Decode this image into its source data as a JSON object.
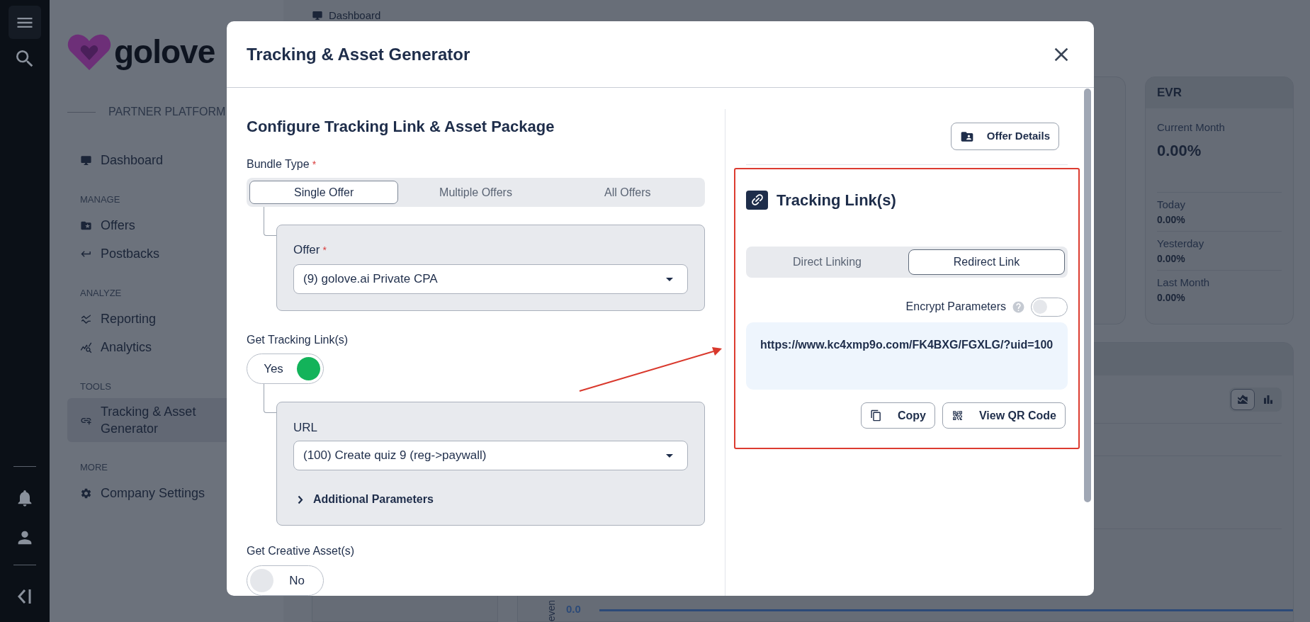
{
  "sidebar": {
    "logo": "golove",
    "subtitle": "PARTNER PLATFORM",
    "sections": [
      {
        "items": [
          {
            "label": "Dashboard",
            "selected": false
          }
        ]
      },
      {
        "heading": "MANAGE",
        "items": [
          {
            "label": "Offers",
            "selected": false
          },
          {
            "label": "Postbacks",
            "selected": false
          }
        ]
      },
      {
        "heading": "ANALYZE",
        "items": [
          {
            "label": "Reporting",
            "selected": false
          },
          {
            "label": "Analytics",
            "selected": false
          }
        ]
      },
      {
        "heading": "TOOLS",
        "items": [
          {
            "label": "Tracking & Asset Generator",
            "selected": true
          }
        ]
      },
      {
        "heading": "MORE",
        "items": [
          {
            "label": "Company Settings",
            "selected": false
          }
        ]
      }
    ]
  },
  "breadcrumb": "Dashboard",
  "evr_card": {
    "title": "EVR",
    "current_label": "Current Month",
    "current_value": "0.00%",
    "rows": [
      {
        "label": "Today",
        "value": "0.00%"
      },
      {
        "label": "Yesterday",
        "value": "0.00%"
      },
      {
        "label": "Last Month",
        "value": "0.00%"
      }
    ]
  },
  "chart": {
    "view_toggle": [
      {
        "selected": true
      },
      {
        "selected": false
      }
    ],
    "y_tick": "0.0",
    "axis_label": "even"
  },
  "modal": {
    "title": "Tracking & Asset Generator",
    "section_title": "Configure Tracking Link & Asset Package",
    "bundle_type": {
      "label": "Bundle Type",
      "required_mark": "*",
      "options": [
        {
          "label": "Single Offer",
          "selected": true
        },
        {
          "label": "Multiple Offers",
          "selected": false
        },
        {
          "label": "All Offers",
          "selected": false
        }
      ]
    },
    "offer": {
      "label": "Offer",
      "required_mark": "*",
      "value": "(9) golove.ai Private CPA"
    },
    "tracking_link": {
      "label": "Get Tracking Link(s)",
      "on": true,
      "text": "Yes"
    },
    "url": {
      "label": "URL",
      "value": "(100) Create quiz 9 (reg->paywall)"
    },
    "additional_parameters": {
      "label": "Additional Parameters",
      "expanded": false
    },
    "creative_asset": {
      "label": "Get Creative Asset(s)",
      "on": false,
      "text": "No"
    },
    "offer_details_button": "Offer Details",
    "tracking_links": {
      "title": "Tracking Link(s)",
      "link_types": [
        {
          "label": "Direct Linking",
          "selected": false
        },
        {
          "label": "Redirect Link",
          "selected": true
        }
      ],
      "encrypt": {
        "label": "Encrypt Parameters",
        "on": false
      },
      "link": "https://www.kc4xmp9o.com/FK4BXG/FGXLG/?uid=100",
      "buttons": [
        "Copy",
        "View QR Code"
      ]
    }
  }
}
